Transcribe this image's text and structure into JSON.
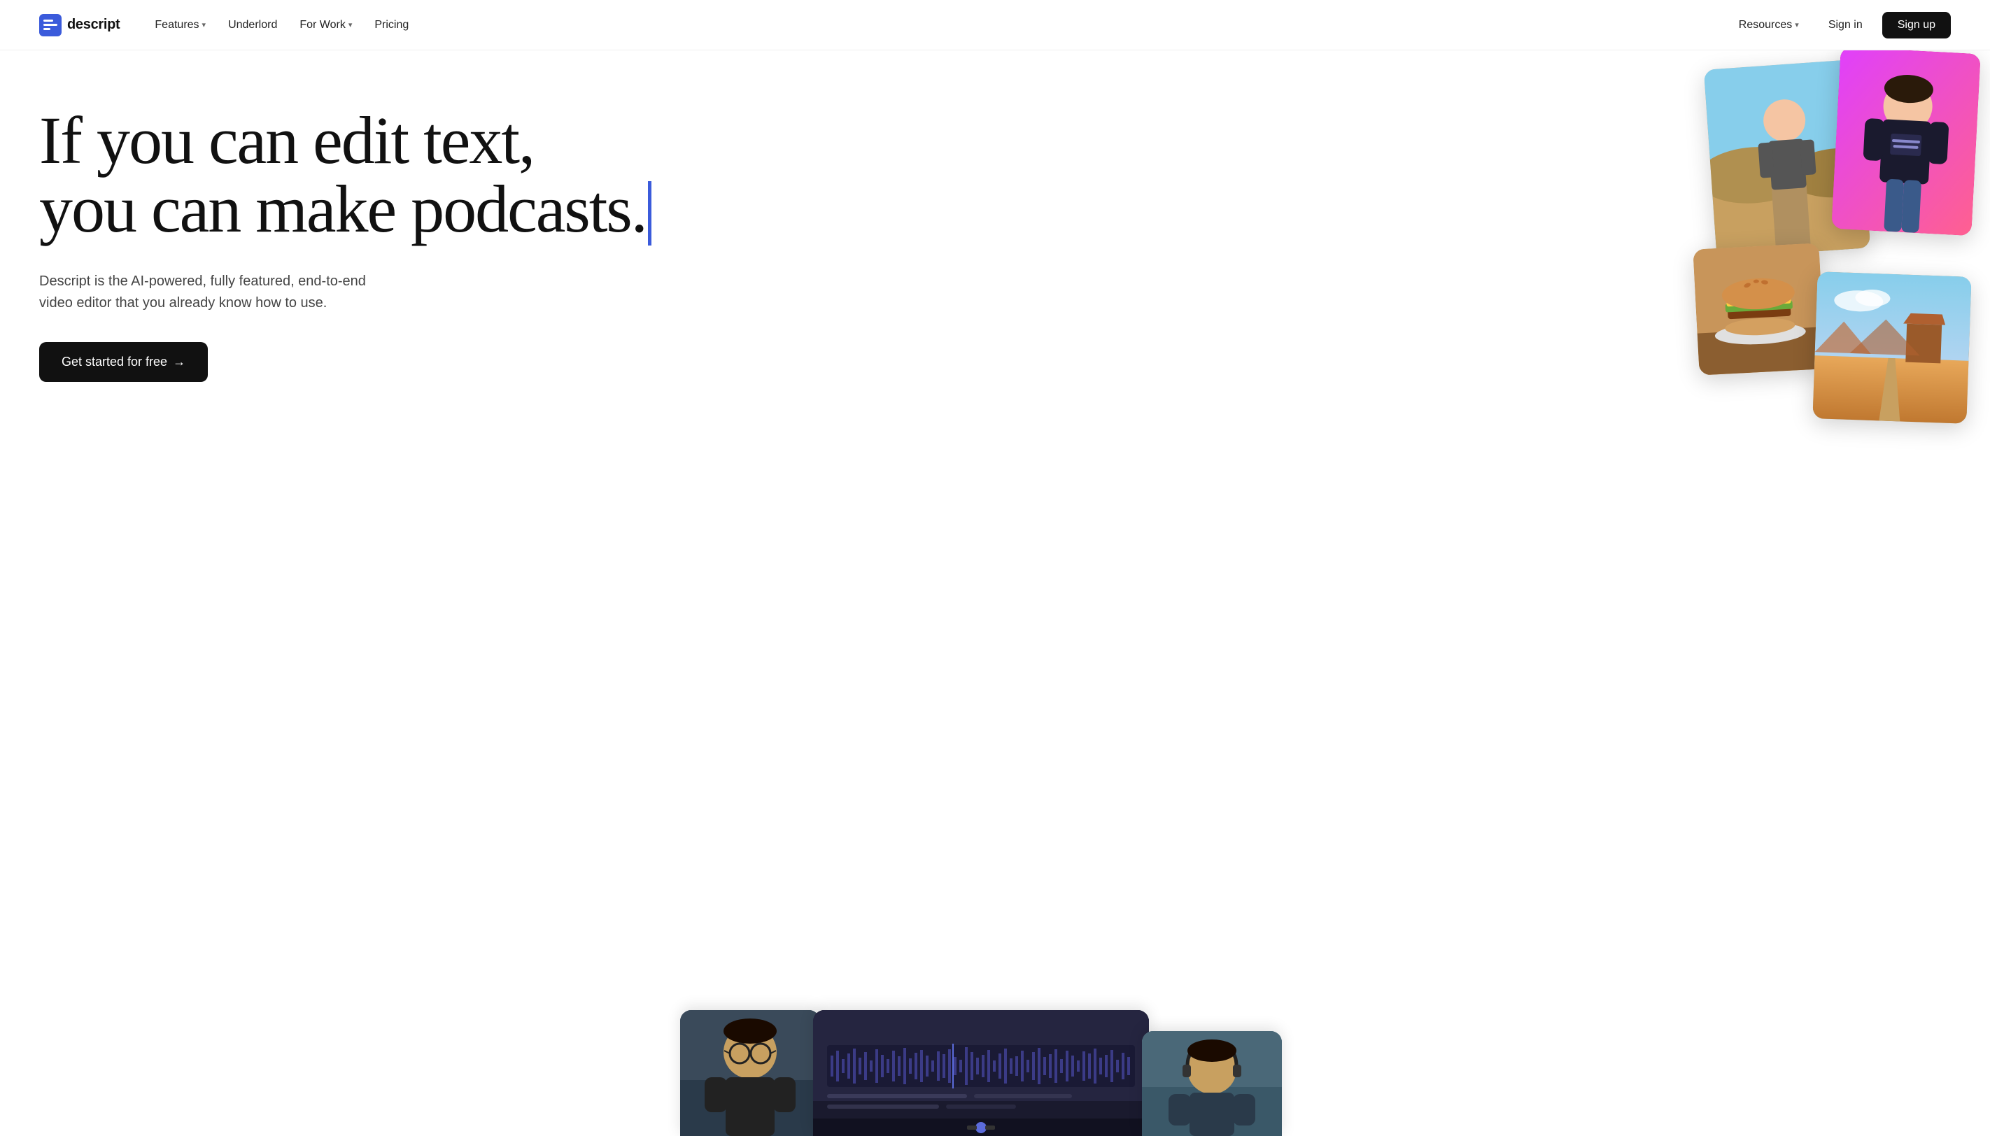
{
  "nav": {
    "logo_text": "descript",
    "links": [
      {
        "label": "Features",
        "has_dropdown": true,
        "id": "features"
      },
      {
        "label": "Underlord",
        "has_dropdown": false,
        "id": "underlord"
      },
      {
        "label": "For Work",
        "has_dropdown": true,
        "id": "for-work"
      },
      {
        "label": "Pricing",
        "has_dropdown": false,
        "id": "pricing"
      }
    ],
    "right_links": [
      {
        "label": "Resources",
        "has_dropdown": true,
        "id": "resources"
      },
      {
        "label": "Sign in",
        "id": "sign-in"
      },
      {
        "label": "Sign up",
        "id": "sign-up"
      }
    ]
  },
  "hero": {
    "headline_line1": "If you can edit text,",
    "headline_line2": "you can make podcasts.",
    "subtext": "Descript is the AI-powered, fully featured, end-to-end video editor that you already know how to use.",
    "cta_label": "Get started for free",
    "cta_arrow": "→"
  }
}
